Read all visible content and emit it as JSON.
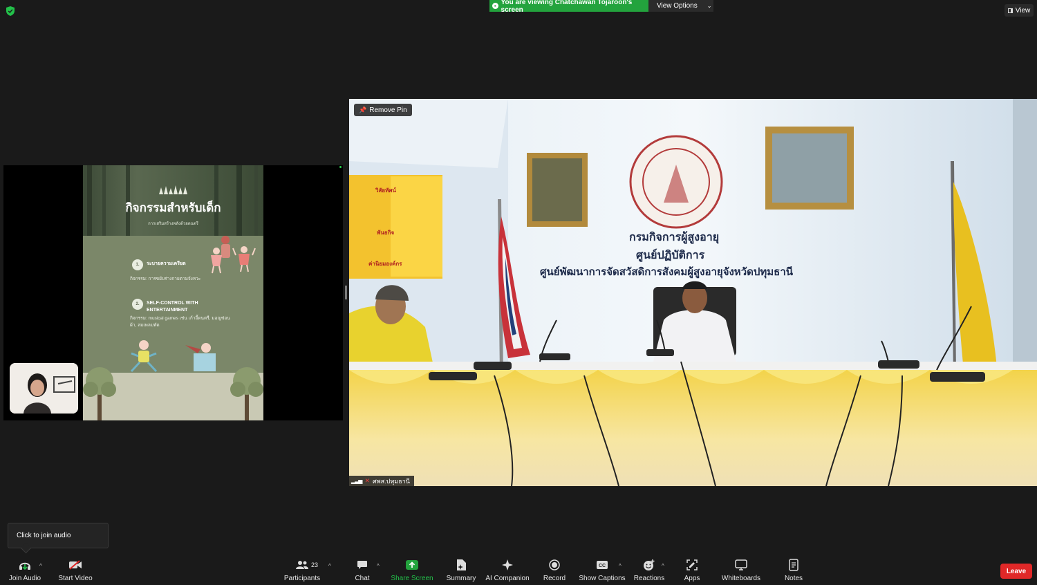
{
  "banner": {
    "viewing_text": "You are viewing Chatchawan Tojaroon's screen",
    "view_options": "View Options"
  },
  "top_view_label": "View",
  "slide": {
    "title": "กิจกรรมสำหรับเด็ก",
    "subtitle": "การเสริมสร้างพลังด้วยดนตรี",
    "items": [
      {
        "num": "1.",
        "title": "ระบายความเครียด",
        "desc": "กิจกรรม: การขยับร่างกายตามจังหวะ"
      },
      {
        "num": "2.",
        "title": "SELF-CONTROL WITH ENTERTAINMENT",
        "desc": "กิจกรรม: musical games เช่น เก้าอี้ดนตรี, มอญซ่อนผ้า, ลมเพลมพัด"
      }
    ]
  },
  "video": {
    "remove_pin": "Remove Pin",
    "participant_name": "ศพส.ปทุมธานี",
    "sign_line1": "กรมกิจการผู้สูงอายุ",
    "sign_line2": "ศูนย์ปฏิบัติการ",
    "sign_line3": "ศูนย์พัฒนาการจัดสวัสดิการสังคมผู้สูงอายุจังหวัดปทุมธานี",
    "board_title1": "วิสัยทัศน์",
    "board_title2": "พันธกิจ",
    "board_title3": "ค่านิยมองค์กร"
  },
  "audio_tooltip": "Click to join audio",
  "toolbar": {
    "join_audio": "Join Audio",
    "start_video": "Start Video",
    "participants": "Participants",
    "participants_count": "23",
    "chat": "Chat",
    "share_screen": "Share Screen",
    "summary": "Summary",
    "ai_companion": "AI Companion",
    "record": "Record",
    "show_captions": "Show Captions",
    "reactions": "Reactions",
    "apps": "Apps",
    "whiteboards": "Whiteboards",
    "notes": "Notes",
    "leave": "Leave"
  },
  "colors": {
    "share_green": "#23a33d",
    "leave_red": "#e02828",
    "background": "#1a1a1a"
  }
}
